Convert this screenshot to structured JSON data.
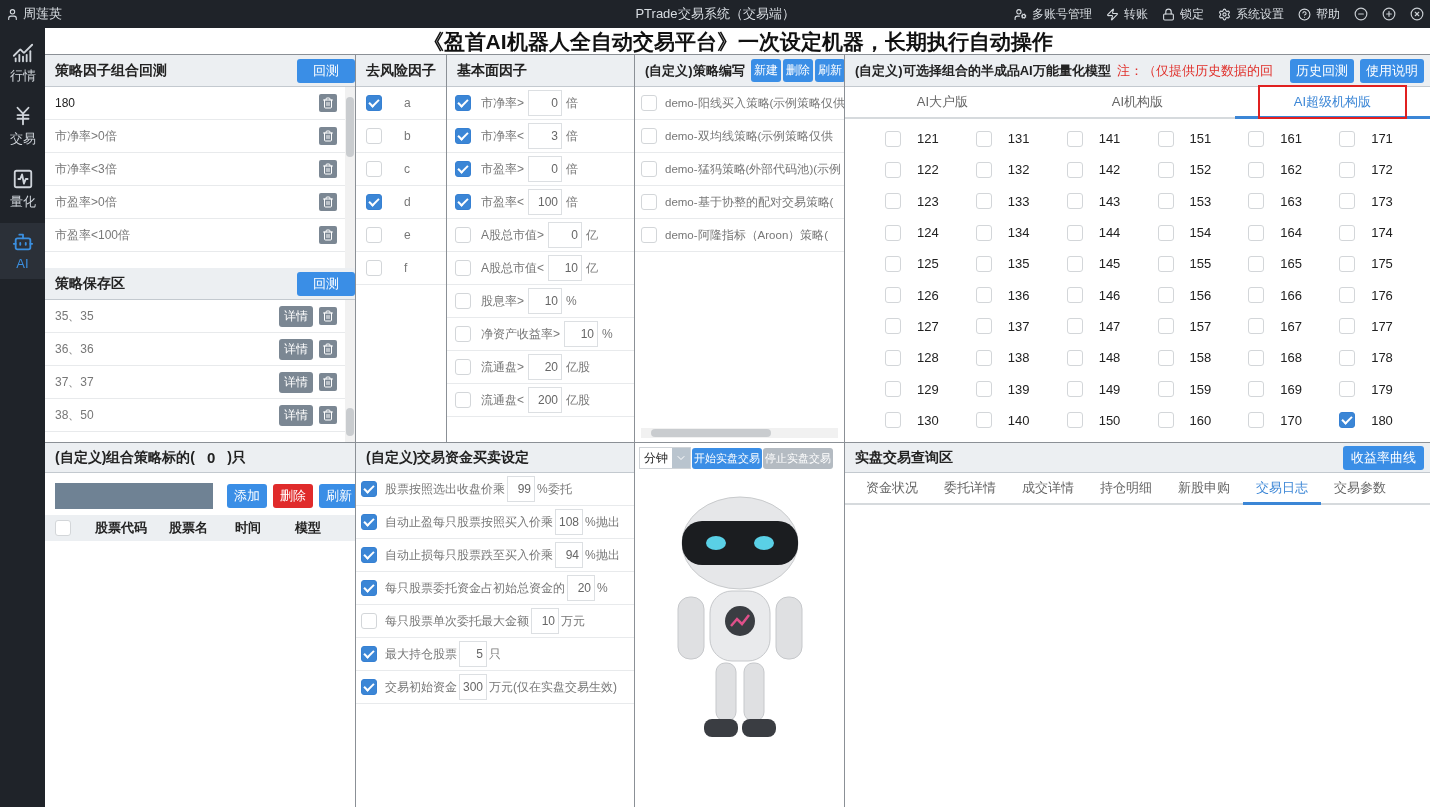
{
  "titlebar": {
    "user": "周莲英",
    "title": "PTrade交易系统（交易端）",
    "actions": [
      {
        "label": "多账号管理",
        "kind": "accounts"
      },
      {
        "label": "转账",
        "kind": "transfer"
      },
      {
        "label": "锁定",
        "kind": "lock"
      },
      {
        "label": "系统设置",
        "kind": "settings"
      },
      {
        "label": "帮助",
        "kind": "help"
      }
    ]
  },
  "sidebar": {
    "items": [
      {
        "label": "行情",
        "kind": "market",
        "selected": false
      },
      {
        "label": "交易",
        "kind": "trade",
        "selected": false
      },
      {
        "label": "量化",
        "kind": "quant",
        "selected": false
      },
      {
        "label": "AI",
        "kind": "ai",
        "selected": true
      }
    ]
  },
  "headline": "《盈首AI机器人全自动交易平台》一次设定机器，长期执行自动操作",
  "factor_backtest": {
    "title": "策略因子组合回测",
    "button": "回测",
    "rows": [
      {
        "label": "180",
        "kind": "name"
      },
      {
        "label": "市净率>0倍",
        "kind": "condition"
      },
      {
        "label": "市净率<3倍",
        "kind": "condition"
      },
      {
        "label": "市盈率>0倍",
        "kind": "condition"
      },
      {
        "label": "市盈率<100倍",
        "kind": "condition"
      }
    ]
  },
  "saved": {
    "title": "策略保存区",
    "button": "回测",
    "rows": [
      {
        "label": "35、35",
        "detail": "详情"
      },
      {
        "label": "36、36",
        "detail": "详情"
      },
      {
        "label": "37、37",
        "detail": "详情"
      },
      {
        "label": "38、50",
        "detail": "详情"
      }
    ]
  },
  "risk_factors": {
    "title": "去风险因子",
    "items": [
      {
        "label": "a",
        "checked": true
      },
      {
        "label": "b",
        "checked": false
      },
      {
        "label": "c",
        "checked": false
      },
      {
        "label": "d",
        "checked": true
      },
      {
        "label": "e",
        "checked": false
      },
      {
        "label": "f",
        "checked": false
      }
    ]
  },
  "fundamentals": {
    "title": "基本面因子",
    "rows": [
      {
        "label": "市净率>",
        "value": "0",
        "unit": "倍",
        "checked": true
      },
      {
        "label": "市净率<",
        "value": "3",
        "unit": "倍",
        "checked": true
      },
      {
        "label": "市盈率>",
        "value": "0",
        "unit": "倍",
        "checked": true
      },
      {
        "label": "市盈率<",
        "value": "100",
        "unit": "倍",
        "checked": true
      },
      {
        "label": "A股总市值>",
        "value": "0",
        "unit": "亿",
        "checked": false
      },
      {
        "label": "A股总市值<",
        "value": "10",
        "unit": "亿",
        "checked": false
      },
      {
        "label": "股息率>",
        "value": "10",
        "unit": "%",
        "checked": false
      },
      {
        "label": "净资产收益率>",
        "value": "10",
        "unit": "%",
        "checked": false
      },
      {
        "label": "流通盘>",
        "value": "20",
        "unit": "亿股",
        "checked": false
      },
      {
        "label": "流通盘<",
        "value": "200",
        "unit": "亿股",
        "checked": false
      }
    ]
  },
  "strategies": {
    "title": "(自定义)策略编写",
    "buttons": [
      "新建",
      "删除",
      "刷新"
    ],
    "items": [
      {
        "label": "demo-阳线买入策略(示例策略仅供",
        "checked": false
      },
      {
        "label": "demo-双均线策略(示例策略仅供",
        "checked": false
      },
      {
        "label": "demo-猛犸策略(外部代码池)(示例",
        "checked": false
      },
      {
        "label": "demo-基于协整的配对交易策略(",
        "checked": false
      },
      {
        "label": "demo-阿隆指标（Aroon）策略(",
        "checked": false
      }
    ]
  },
  "models": {
    "title": "(自定义)可选择组合的半成品AI万能量化模型",
    "note": "注：（仅提供历史数据的回",
    "buttons": [
      "历史回测",
      "使用说明"
    ],
    "tabs": [
      {
        "label": "AI大户版",
        "selected": false
      },
      {
        "label": "AI机构版",
        "selected": false
      },
      {
        "label": "AI超级机构版",
        "selected": true
      }
    ],
    "options": [
      {
        "label": "121",
        "checked": false
      },
      {
        "label": "122",
        "checked": false
      },
      {
        "label": "123",
        "checked": false
      },
      {
        "label": "124",
        "checked": false
      },
      {
        "label": "125",
        "checked": false
      },
      {
        "label": "126",
        "checked": false
      },
      {
        "label": "127",
        "checked": false
      },
      {
        "label": "128",
        "checked": false
      },
      {
        "label": "129",
        "checked": false
      },
      {
        "label": "130",
        "checked": false
      },
      {
        "label": "131",
        "checked": false
      },
      {
        "label": "132",
        "checked": false
      },
      {
        "label": "133",
        "checked": false
      },
      {
        "label": "134",
        "checked": false
      },
      {
        "label": "135",
        "checked": false
      },
      {
        "label": "136",
        "checked": false
      },
      {
        "label": "137",
        "checked": false
      },
      {
        "label": "138",
        "checked": false
      },
      {
        "label": "139",
        "checked": false
      },
      {
        "label": "140",
        "checked": false
      },
      {
        "label": "141",
        "checked": false
      },
      {
        "label": "142",
        "checked": false
      },
      {
        "label": "143",
        "checked": false
      },
      {
        "label": "144",
        "checked": false
      },
      {
        "label": "145",
        "checked": false
      },
      {
        "label": "146",
        "checked": false
      },
      {
        "label": "147",
        "checked": false
      },
      {
        "label": "148",
        "checked": false
      },
      {
        "label": "149",
        "checked": false
      },
      {
        "label": "150",
        "checked": false
      },
      {
        "label": "151",
        "checked": false
      },
      {
        "label": "152",
        "checked": false
      },
      {
        "label": "153",
        "checked": false
      },
      {
        "label": "154",
        "checked": false
      },
      {
        "label": "155",
        "checked": false
      },
      {
        "label": "156",
        "checked": false
      },
      {
        "label": "157",
        "checked": false
      },
      {
        "label": "158",
        "checked": false
      },
      {
        "label": "159",
        "checked": false
      },
      {
        "label": "160",
        "checked": false
      },
      {
        "label": "161",
        "checked": false
      },
      {
        "label": "162",
        "checked": false
      },
      {
        "label": "163",
        "checked": false
      },
      {
        "label": "164",
        "checked": false
      },
      {
        "label": "165",
        "checked": false
      },
      {
        "label": "166",
        "checked": false
      },
      {
        "label": "167",
        "checked": false
      },
      {
        "label": "168",
        "checked": false
      },
      {
        "label": "169",
        "checked": false
      },
      {
        "label": "170",
        "checked": false
      },
      {
        "label": "171",
        "checked": false
      },
      {
        "label": "172",
        "checked": false
      },
      {
        "label": "173",
        "checked": false
      },
      {
        "label": "174",
        "checked": false
      },
      {
        "label": "175",
        "checked": false
      },
      {
        "label": "176",
        "checked": false
      },
      {
        "label": "177",
        "checked": false
      },
      {
        "label": "178",
        "checked": false
      },
      {
        "label": "179",
        "checked": false
      },
      {
        "label": "180",
        "checked": true
      }
    ]
  },
  "portfolio": {
    "title_prefix": "(自定义)组合策略标的(",
    "count": "0",
    "title_suffix": ")只",
    "buttons": [
      {
        "label": "添加",
        "kind": "primary"
      },
      {
        "label": "删除",
        "kind": "danger"
      },
      {
        "label": "刷新",
        "kind": "primary"
      }
    ],
    "select_all": {
      "checked": false
    },
    "columns": [
      "股票代码",
      "股票名",
      "时间",
      "模型"
    ]
  },
  "trade_settings": {
    "title": "(自定义)交易资金买卖设定",
    "rows": [
      {
        "label": "股票按照选出收盘价乘",
        "value": "99",
        "unit": "%委托",
        "checked": true
      },
      {
        "label": "自动止盈每只股票按照买入价乘",
        "value": "108",
        "unit": "%抛出",
        "checked": true
      },
      {
        "label": "自动止损每只股票跌至买入价乘",
        "value": "94",
        "unit": "%抛出",
        "checked": true
      },
      {
        "label": "每只股票委托资金占初始总资金的",
        "value": "20",
        "unit": "%",
        "checked": true
      },
      {
        "label": "每只股票单次委托最大金额",
        "value": "10",
        "unit": "万元",
        "checked": false
      },
      {
        "label": "最大持仓股票",
        "value": "5",
        "unit": "只",
        "checked": true
      },
      {
        "label": "交易初始资金",
        "value": "300",
        "unit": "万元(仅在实盘交易生效)",
        "checked": true
      }
    ]
  },
  "live": {
    "interval": "分钟",
    "buttons": [
      {
        "label": "开始实盘交易",
        "kind": "start"
      },
      {
        "label": "停止实盘交易",
        "kind": "stop"
      }
    ]
  },
  "query": {
    "title": "实盘交易查询区",
    "button": "收益率曲线",
    "tabs": [
      {
        "label": "资金状况",
        "selected": false
      },
      {
        "label": "委托详情",
        "selected": false
      },
      {
        "label": "成交详情",
        "selected": false
      },
      {
        "label": "持仓明细",
        "selected": false
      },
      {
        "label": "新股申购",
        "selected": false
      },
      {
        "label": "交易日志",
        "selected": true
      },
      {
        "label": "交易参数",
        "selected": false
      }
    ]
  }
}
